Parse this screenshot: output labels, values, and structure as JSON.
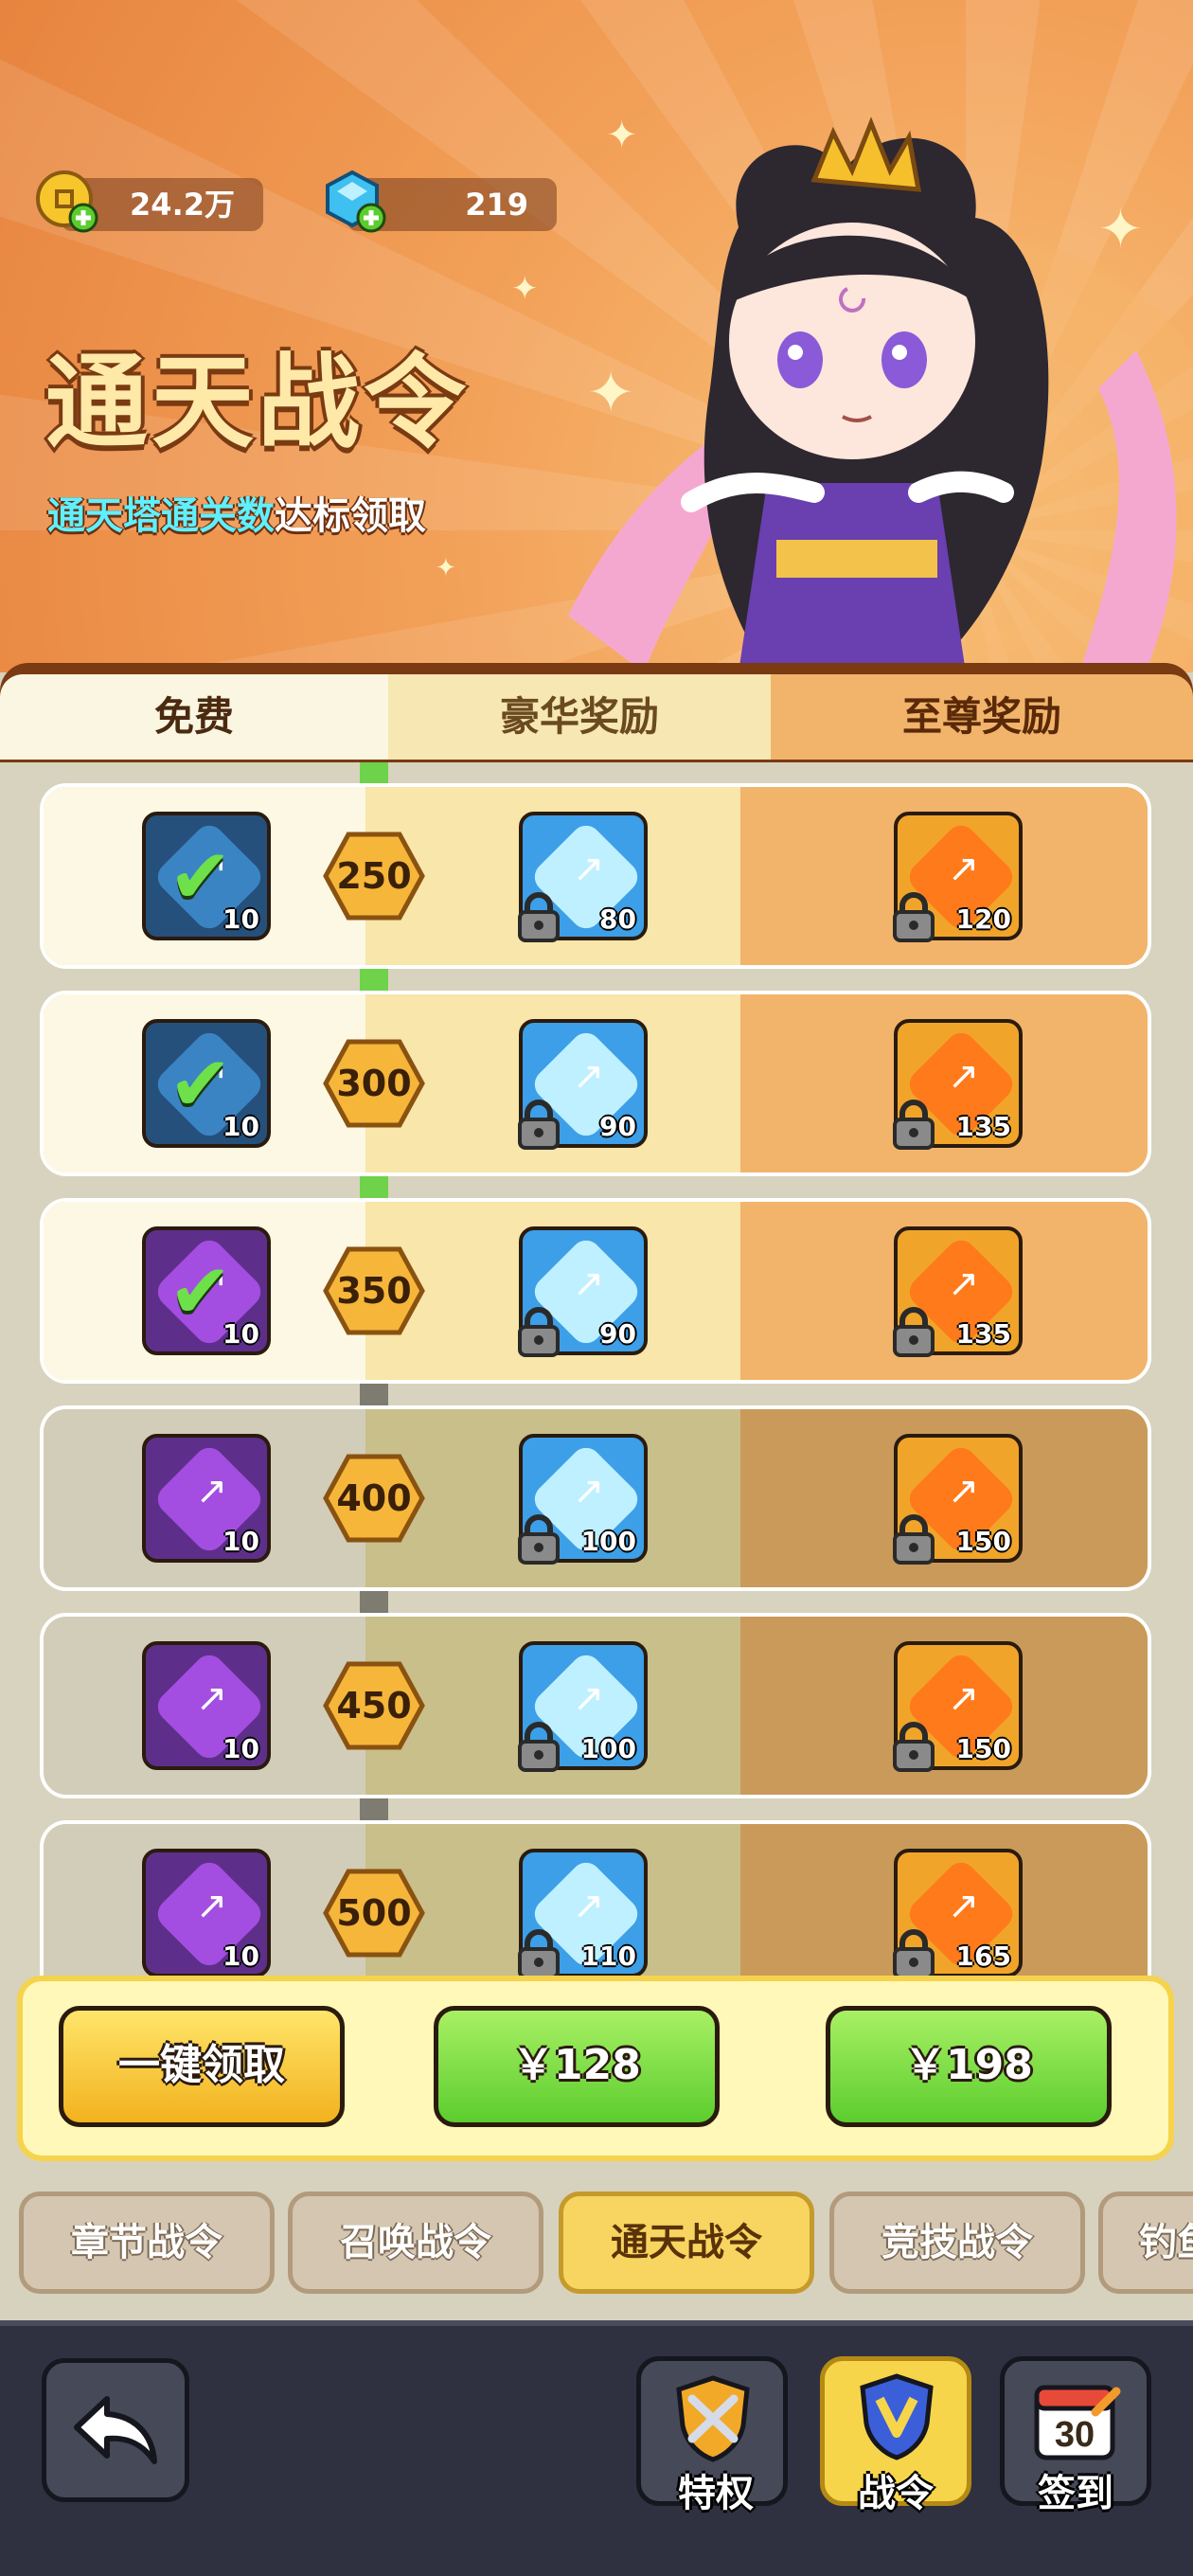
{
  "resources": {
    "gold": {
      "value": "24.2万",
      "icon": "gold-coin-plus-icon"
    },
    "gems": {
      "value": "219",
      "icon": "blue-gem-plus-icon"
    }
  },
  "header": {
    "title": "通天战令",
    "subtitle_highlight": "通天塔通关数",
    "subtitle_rest": "达标领取"
  },
  "tabs": {
    "free": "免费",
    "luxury": "豪华奖励",
    "supreme": "至尊奖励"
  },
  "rewards": [
    {
      "level": "250",
      "free_qty": "10",
      "free_color": "blue",
      "free_claimed": true,
      "lux_qty": "80",
      "sup_qty": "120",
      "unlocked": true
    },
    {
      "level": "300",
      "free_qty": "10",
      "free_color": "blue",
      "free_claimed": true,
      "lux_qty": "90",
      "sup_qty": "135",
      "unlocked": true
    },
    {
      "level": "350",
      "free_qty": "10",
      "free_color": "purple",
      "free_claimed": true,
      "lux_qty": "90",
      "sup_qty": "135",
      "unlocked": true
    },
    {
      "level": "400",
      "free_qty": "10",
      "free_color": "purple",
      "free_claimed": false,
      "lux_qty": "100",
      "sup_qty": "150",
      "unlocked": false
    },
    {
      "level": "450",
      "free_qty": "10",
      "free_color": "purple",
      "free_claimed": false,
      "lux_qty": "100",
      "sup_qty": "150",
      "unlocked": false
    },
    {
      "level": "500",
      "free_qty": "10",
      "free_color": "purple",
      "free_claimed": false,
      "lux_qty": "110",
      "sup_qty": "165",
      "unlocked": false
    }
  ],
  "actions": {
    "claim_all": "一键领取",
    "luxury_price": "￥128",
    "supreme_price": "￥198"
  },
  "pass_tabs": [
    {
      "label": "章节战令",
      "active": false
    },
    {
      "label": "召唤战令",
      "active": false
    },
    {
      "label": "通天战令",
      "active": true
    },
    {
      "label": "竞技战令",
      "active": false
    },
    {
      "label": "钓鱼",
      "active": false
    }
  ],
  "nav": {
    "privilege": "特权",
    "battle_pass": "战令",
    "sign_in": "签到",
    "calendar_number": "30"
  },
  "colors": {
    "progress_green": "#6ed34a",
    "gold_button": "#f2b21e",
    "green_button": "#5ccd2e",
    "header_orange": "#f3a25a"
  }
}
